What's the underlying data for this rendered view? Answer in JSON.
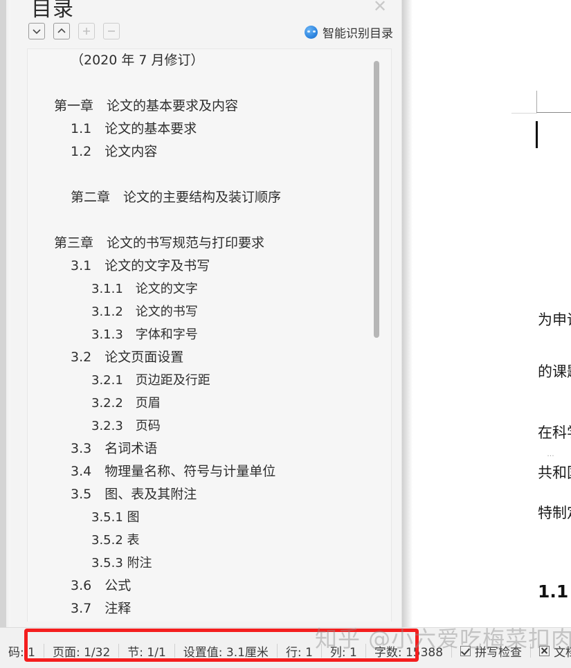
{
  "panel": {
    "title": "目录",
    "close_icon": "✕",
    "toolbar": {
      "buttons": [
        {
          "name": "expand-down-button",
          "icon": "chevron-down-icon",
          "label": "展开",
          "disabled": false
        },
        {
          "name": "collapse-up-button",
          "icon": "chevron-up-icon",
          "label": "折叠",
          "disabled": false
        },
        {
          "name": "promote-button",
          "icon": "plus-icon",
          "label": "升级",
          "disabled": true
        },
        {
          "name": "demote-button",
          "icon": "minus-icon",
          "label": "降级",
          "disabled": true
        }
      ],
      "smart_toc": {
        "icon": "smart-face-icon",
        "label": "智能识别目录"
      }
    }
  },
  "toc": {
    "items": [
      {
        "text": "（2020 年 7 月修订）",
        "level": 1,
        "chevron": "none"
      },
      {
        "text": "",
        "level": 0,
        "chevron": "none"
      },
      {
        "text": "第一章　论文的基本要求及内容",
        "level": 0,
        "chevron": "down"
      },
      {
        "text": "1.1　论文的基本要求",
        "level": 1,
        "chevron": "none"
      },
      {
        "text": "1.2　论文内容",
        "level": 1,
        "chevron": "none"
      },
      {
        "text": "",
        "level": 0,
        "chevron": "none"
      },
      {
        "text": "第二章　论文的主要结构及装订顺序",
        "level": 1,
        "chevron": "none"
      },
      {
        "text": "",
        "level": 0,
        "chevron": "none"
      },
      {
        "text": "第三章　论文的书写规范与打印要求",
        "level": 0,
        "chevron": "down"
      },
      {
        "text": "3.1　论文的文字及书写",
        "level": 1,
        "chevron": "down"
      },
      {
        "text": "3.1.1　论文的文字",
        "level": 2,
        "chevron": "none"
      },
      {
        "text": "3.1.2　论文的书写",
        "level": 2,
        "chevron": "none"
      },
      {
        "text": "3.1.3　字体和字号",
        "level": 2,
        "chevron": "none"
      },
      {
        "text": "3.2　论文页面设置",
        "level": 1,
        "chevron": "down"
      },
      {
        "text": "3.2.1　页边距及行距",
        "level": 2,
        "chevron": "none"
      },
      {
        "text": "3.2.2　页眉",
        "level": 2,
        "chevron": "none"
      },
      {
        "text": "3.2.3　页码",
        "level": 2,
        "chevron": "none"
      },
      {
        "text": "3.3　名词术语",
        "level": 1,
        "chevron": "none"
      },
      {
        "text": "3.4　物理量名称、符号与计量单位",
        "level": 1,
        "chevron": "none"
      },
      {
        "text": "3.5　图、表及其附注",
        "level": 1,
        "chevron": "down"
      },
      {
        "text": "3.5.1 图",
        "level": 2,
        "chevron": "none"
      },
      {
        "text": "3.5.2 表",
        "level": 2,
        "chevron": "none"
      },
      {
        "text": "3.5.3 附注",
        "level": 2,
        "chevron": "none"
      },
      {
        "text": "3.6　公式",
        "level": 1,
        "chevron": "none"
      },
      {
        "text": "3.7　注释",
        "level": 1,
        "chevron": "none"
      }
    ],
    "scrollbar": {
      "name": "toc-vertical-scrollbar"
    }
  },
  "document": {
    "lines": [
      "为申请",
      "的课题",
      "在科学",
      "共和国",
      "特制定"
    ],
    "ellipsis": "…",
    "heading": "1.1"
  },
  "statusbar": {
    "items": [
      {
        "name": "page-number-status",
        "label": "码: 1",
        "icon": "none"
      },
      {
        "name": "page-status",
        "label": "页面: 1/32",
        "icon": "none"
      },
      {
        "name": "section-status",
        "label": "节: 1/1",
        "icon": "none"
      },
      {
        "name": "setting-value-status",
        "label": "设置值: 3.1厘米",
        "icon": "none"
      },
      {
        "name": "line-status",
        "label": "行: 1",
        "icon": "none"
      },
      {
        "name": "column-status",
        "label": "列: 1",
        "icon": "none"
      },
      {
        "name": "word-count-status",
        "label": "字数: 15388",
        "icon": "none"
      },
      {
        "name": "spell-check-status",
        "label": "拼写检查",
        "icon": "checkbox-checked-icon"
      },
      {
        "name": "document-check-status",
        "label": "文档校",
        "icon": "checkbox-cross-icon"
      }
    ]
  },
  "annotation": {
    "highlight_color": "#f41e1e",
    "watermark": "知乎 @小六爱吃梅菜扣肉"
  }
}
